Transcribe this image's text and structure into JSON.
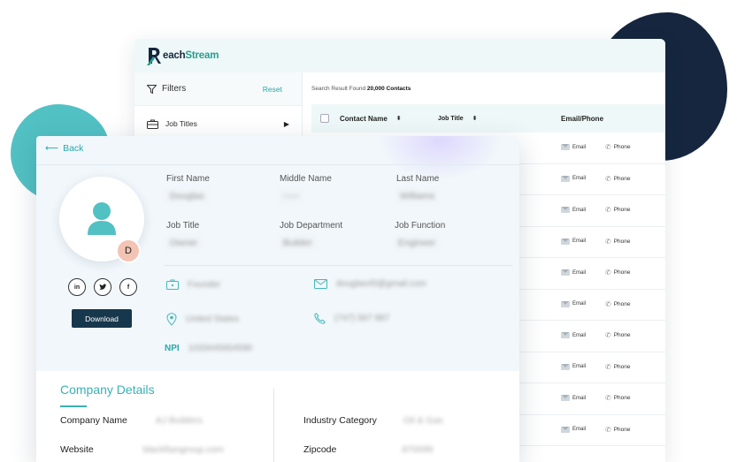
{
  "brand": {
    "logo_prefix": "R",
    "logo_text_dark": "each",
    "logo_text_accent": "Stream"
  },
  "listing": {
    "filters_label": "Filters",
    "reset_label": "Reset",
    "job_titles_label": "Job Titles",
    "result_prefix": "Search Result Found",
    "result_count": "20,000 Contacts",
    "columns": [
      "Contact Name",
      "Job Title",
      "Email/Phone"
    ],
    "email_label": "Email",
    "phone_label": "Phone",
    "row_count": 10
  },
  "profile": {
    "back_label": "Back",
    "badge_letter": "D",
    "download_label": "Download",
    "socials": [
      "in",
      "tw",
      "f"
    ],
    "fields": {
      "first_name_label": "First Name",
      "first_name_value": "Douglas",
      "middle_name_label": "Middle Name",
      "middle_name_value": "-----",
      "last_name_label": "Last Name",
      "last_name_value": "Williams",
      "job_title_label": "Job Title",
      "job_title_value": "Owner",
      "job_department_label": "Job Department",
      "job_department_value": "Builder",
      "job_function_label": "Job Function",
      "job_function_value": "Engineer"
    },
    "contact": {
      "title_value": "Founder",
      "email_value": "douglas45@gmail.com",
      "location_value": "United States",
      "phone_value": "(747) 567 887",
      "npi_label": "NPI",
      "npi_value": "1033445654590"
    }
  },
  "company": {
    "section_title": "Company Details",
    "company_name_label": "Company Name",
    "company_name_value": "AJ Builders",
    "website_label": "Website",
    "website_value": "blackfiangroup.com",
    "industry_label": "Industry Category",
    "industry_value": "Oil & Gas",
    "zipcode_label": "Zipcode",
    "zipcode_value": "870099"
  },
  "colors": {
    "accent": "#3bb0b3",
    "navy": "#15263e",
    "teal_blob": "#52c1c4",
    "button": "#17374c"
  }
}
